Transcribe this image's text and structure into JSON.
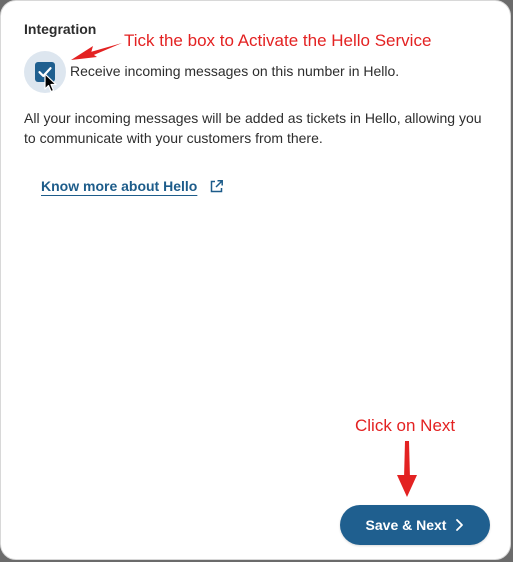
{
  "integration": {
    "section_title": "Integration",
    "checkbox_label": "Receive incoming messages on this number in Hello.",
    "checkbox_checked": true,
    "description": "All your incoming messages will be added as tickets in Hello, allowing you to communicate with your customers from there.",
    "know_more_link": "Know more about Hello"
  },
  "annotations": {
    "tick_box": "Tick the box to Activate the Hello Service",
    "click_next": "Click on Next",
    "color": "#e32222"
  },
  "footer": {
    "save_next_label": "Save & Next"
  },
  "colors": {
    "primary": "#1f5f8f",
    "link": "#1d5c8a",
    "text": "#2d2d2d"
  },
  "icons": {
    "checkbox": "check-icon",
    "link": "external-link-icon",
    "button": "chevron-right-icon",
    "pointer": "mouse-pointer-icon"
  }
}
